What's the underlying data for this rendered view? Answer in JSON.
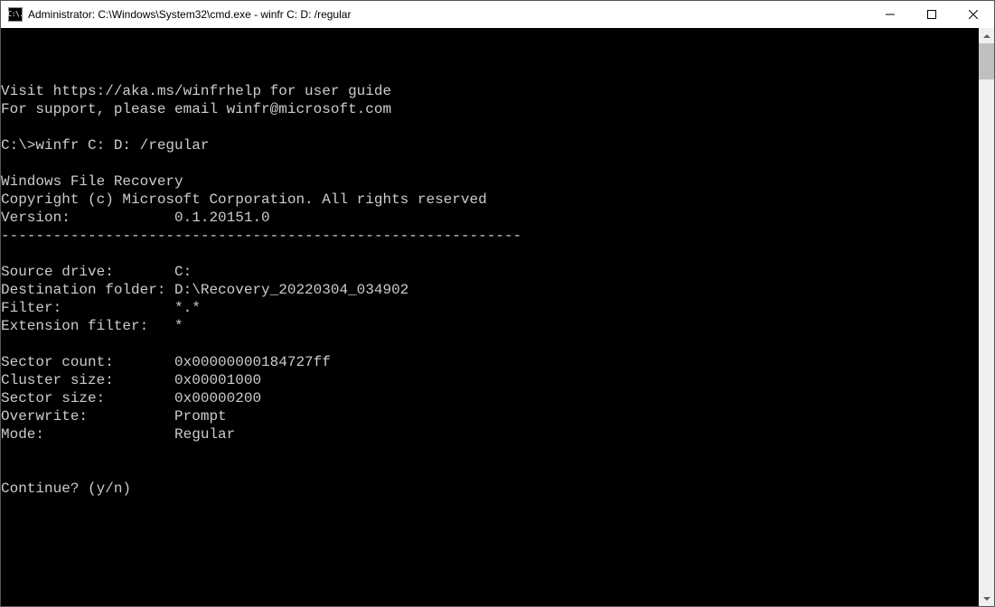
{
  "title": "Administrator: C:\\Windows\\System32\\cmd.exe - winfr  C: D: /regular",
  "app_icon_text": "C:\\.",
  "terminal_lines": [
    "",
    "",
    "",
    "Visit https://aka.ms/winfrhelp for user guide",
    "For support, please email winfr@microsoft.com",
    "",
    "C:\\>winfr C: D: /regular",
    "",
    "Windows File Recovery",
    "Copyright (c) Microsoft Corporation. All rights reserved",
    "Version:            0.1.20151.0",
    "------------------------------------------------------------",
    "",
    "Source drive:       C:",
    "Destination folder: D:\\Recovery_20220304_034902",
    "Filter:             *.*",
    "Extension filter:   *",
    "",
    "Sector count:       0x00000000184727ff",
    "Cluster size:       0x00001000",
    "Sector size:        0x00000200",
    "Overwrite:          Prompt",
    "Mode:               Regular",
    "",
    "",
    "Continue? (y/n)"
  ]
}
